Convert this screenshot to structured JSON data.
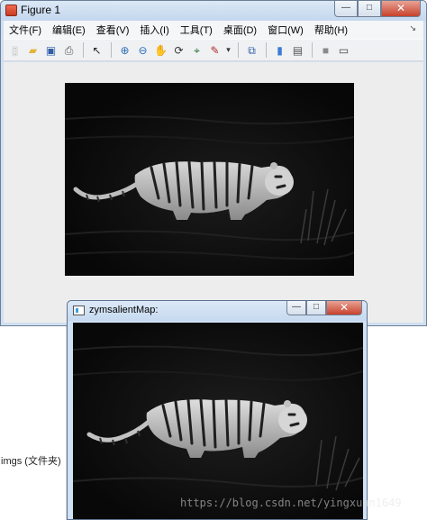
{
  "figure_window": {
    "title": "Figure 1",
    "controls": {
      "minimize": "—",
      "maximize": "□",
      "close": "✕"
    },
    "menu": [
      "文件(F)",
      "编辑(E)",
      "查看(V)",
      "插入(I)",
      "工具(T)",
      "桌面(D)",
      "窗口(W)",
      "帮助(H)"
    ],
    "menu_overflow": "↘",
    "toolbar": [
      {
        "icon": "new-figure-icon",
        "glyph": "▯"
      },
      {
        "icon": "open-file-icon",
        "glyph": "▰"
      },
      {
        "icon": "save-icon",
        "glyph": "▣"
      },
      {
        "icon": "print-icon",
        "glyph": "⎙"
      },
      {
        "icon": "pointer-arrow-icon",
        "glyph": "↖"
      },
      {
        "icon": "zoom-in-icon",
        "glyph": "⊕"
      },
      {
        "icon": "zoom-out-icon",
        "glyph": "⊖"
      },
      {
        "icon": "pan-hand-icon",
        "glyph": "✋"
      },
      {
        "icon": "rotate-3d-icon",
        "glyph": "⟳"
      },
      {
        "icon": "data-cursor-icon",
        "glyph": "⌖"
      },
      {
        "icon": "brush-icon",
        "glyph": "✎"
      },
      {
        "icon": "brush-dropdown-icon",
        "glyph": "▾"
      },
      {
        "icon": "link-plot-icon",
        "glyph": "⧉"
      },
      {
        "icon": "colorbar-icon",
        "glyph": "▮"
      },
      {
        "icon": "legend-icon",
        "glyph": "▤"
      },
      {
        "icon": "hide-plot-tools-icon",
        "glyph": "■"
      },
      {
        "icon": "show-plot-tools-icon",
        "glyph": "▭"
      }
    ]
  },
  "background": {
    "folder_label": "imgs  (文件夹)"
  },
  "saliency_window": {
    "title": "zymsalientMap:",
    "controls": {
      "minimize": "—",
      "maximize": "□",
      "close": "✕"
    }
  },
  "watermark": "https://blog.csdn.net/yingxuan1649",
  "colors": {
    "title_bar": "#c9dbef",
    "canvas": "#ededed",
    "close_button": "#c8412b",
    "image_background": "#0b0b0b"
  }
}
